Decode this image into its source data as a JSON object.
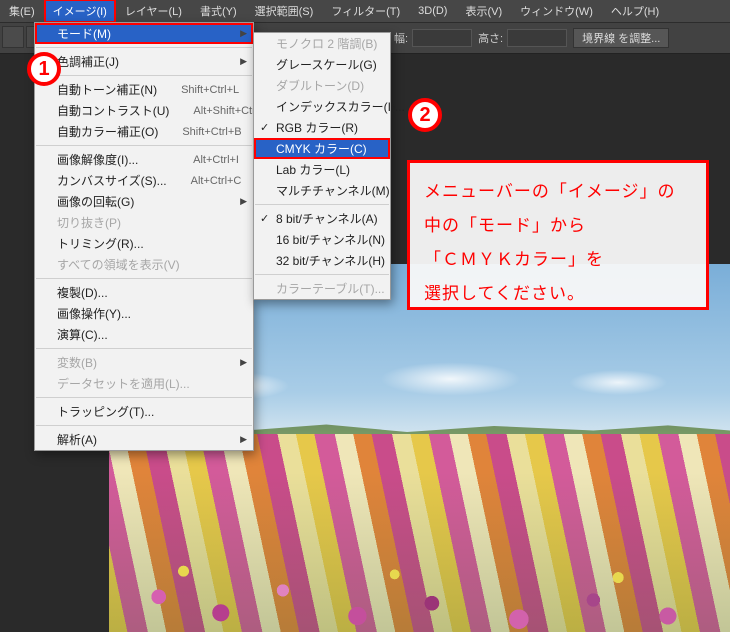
{
  "menubar": {
    "items": [
      "集(E)",
      "イメージ(I)",
      "レイヤー(L)",
      "書式(Y)",
      "選択範囲(S)",
      "フィルター(T)",
      "3D(D)",
      "表示(V)",
      "ウィンドウ(W)",
      "ヘルプ(H)"
    ],
    "selected_index": 1
  },
  "optbar": {
    "width_label": "幅:",
    "height_label": "高さ:",
    "bounds_button": "境界線 を調整..."
  },
  "menu_image": {
    "items": [
      {
        "label": "モード(M)",
        "selected": true,
        "submenu": true
      },
      {
        "sep": true
      },
      {
        "label": "色調補正(J)",
        "submenu": true
      },
      {
        "sep": true
      },
      {
        "label": "自動トーン補正(N)",
        "shortcut": "Shift+Ctrl+L"
      },
      {
        "label": "自動コントラスト(U)",
        "shortcut": "Alt+Shift+Ctrl+L"
      },
      {
        "label": "自動カラー補正(O)",
        "shortcut": "Shift+Ctrl+B"
      },
      {
        "sep": true
      },
      {
        "label": "画像解像度(I)...",
        "shortcut": "Alt+Ctrl+I"
      },
      {
        "label": "カンバスサイズ(S)...",
        "shortcut": "Alt+Ctrl+C"
      },
      {
        "label": "画像の回転(G)",
        "submenu": true
      },
      {
        "label": "切り抜き(P)",
        "disabled": true
      },
      {
        "label": "トリミング(R)..."
      },
      {
        "label": "すべての領域を表示(V)",
        "disabled": true
      },
      {
        "sep": true
      },
      {
        "label": "複製(D)..."
      },
      {
        "label": "画像操作(Y)..."
      },
      {
        "label": "演算(C)..."
      },
      {
        "sep": true
      },
      {
        "label": "変数(B)",
        "disabled": true,
        "submenu": true
      },
      {
        "label": "データセットを適用(L)...",
        "disabled": true
      },
      {
        "sep": true
      },
      {
        "label": "トラッピング(T)..."
      },
      {
        "sep": true
      },
      {
        "label": "解析(A)",
        "submenu": true
      }
    ]
  },
  "menu_mode": {
    "items": [
      {
        "label": "モノクロ 2 階調(B)",
        "disabled": true
      },
      {
        "label": "グレースケール(G)"
      },
      {
        "label": "ダブルトーン(D)",
        "disabled": true
      },
      {
        "label": "インデックスカラー(I)..."
      },
      {
        "label": "RGB カラー(R)",
        "checked": true
      },
      {
        "label": "CMYK カラー(C)",
        "cmyk": true
      },
      {
        "label": "Lab カラー(L)"
      },
      {
        "label": "マルチチャンネル(M)"
      },
      {
        "sep": true
      },
      {
        "label": "8 bit/チャンネル(A)",
        "checked": true
      },
      {
        "label": "16 bit/チャンネル(N)"
      },
      {
        "label": "32 bit/チャンネル(H)"
      },
      {
        "sep": true
      },
      {
        "label": "カラーテーブル(T)...",
        "disabled": true
      }
    ]
  },
  "callouts": {
    "one": "1",
    "two": "2"
  },
  "instruction": {
    "l1": "メニューバーの「イメージ」の",
    "l2": "中の「モード」から",
    "l3": "「ＣＭＹＫカラー」を",
    "l4": "選択してください。"
  }
}
